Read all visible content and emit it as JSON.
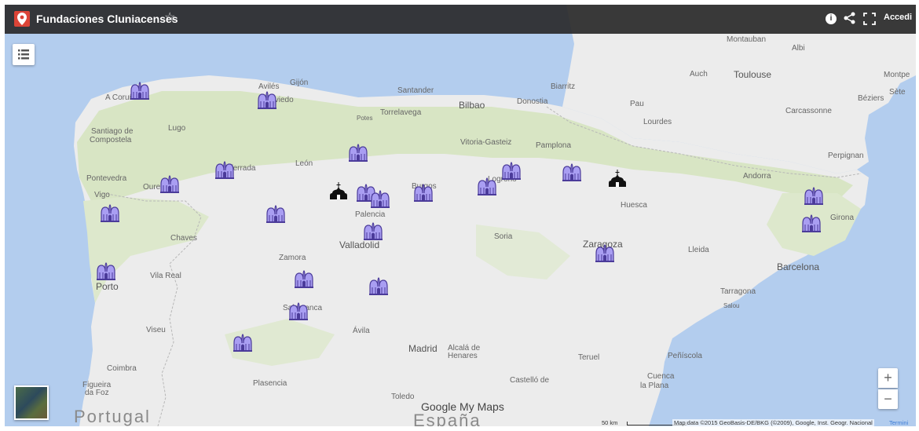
{
  "header": {
    "title": "Fundaciones Cluniacenses",
    "star_glyph": "☆",
    "info_glyph": "i",
    "signin_label": "Accedi"
  },
  "controls": {
    "zoom_in": "+",
    "zoom_out": "−"
  },
  "watermark": "Google My Maps",
  "footer": {
    "scale": "50 km",
    "attribution": "Map data ©2015 GeoBasis-DE/BKG (©2009), Google, Inst. Geogr. Nacional",
    "terms": "Termini"
  },
  "colors": {
    "sea": "#b3cdee",
    "land": "#ececec",
    "green_land": "#d8e5c4",
    "marker_fill": "#a99ef2",
    "marker_stroke": "#4b3b9a",
    "topbar": "#262626",
    "pin": "#db4437"
  },
  "labels": {
    "countries": [
      "Portugal",
      "España"
    ],
    "big_cities": [
      "Bilbao",
      "Toulouse",
      "Porto",
      "Madrid",
      "Barcelona",
      "Zaragoza",
      "Valladolid"
    ],
    "cities": [
      "Montauban",
      "Albi",
      "Auch",
      "Montpe",
      "Béziers",
      "Sète",
      "Carcassonne",
      "Perpignan",
      "Andorra",
      "Girona",
      "Biarritz",
      "Pau",
      "Lourdes",
      "Donostia",
      "Santander",
      "Avilés",
      "Gijón",
      "Oviedo",
      "A Coruña",
      "Torrelavega",
      "Potes",
      "Santiago de",
      "Compostela",
      "Lugo",
      "Vitoria-Gasteiz",
      "Pamplona",
      "León",
      "Ponferrada",
      "Pontevedra",
      "Ourense",
      "Vigo",
      "Burgos",
      "Logroño",
      "Huesca",
      "Palencia",
      "Chaves",
      "Soria",
      "Lleida",
      "Zamora",
      "Vila Real",
      "Salamanca",
      "Tarragona",
      "Salou",
      "Viseu",
      "Ávila",
      "Alcalá de",
      "Henares",
      "Coimbra",
      "Teruel",
      "Peñíscola",
      "Figueira",
      "da Foz",
      "Plasencia",
      "Cuenca",
      "Castelló de",
      "la Plana",
      "Toledo"
    ]
  },
  "markers": [
    {
      "kind": "monastery",
      "name": "monastery-a-coruna"
    },
    {
      "kind": "monastery",
      "name": "monastery-oviedo"
    },
    {
      "kind": "monastery",
      "name": "monastery-ponferrada"
    },
    {
      "kind": "monastery",
      "name": "monastery-ourense"
    },
    {
      "kind": "monastery",
      "name": "monastery-vigo"
    },
    {
      "kind": "monastery",
      "name": "monastery-leon-east"
    },
    {
      "kind": "monastery",
      "name": "monastery-palencia-1"
    },
    {
      "kind": "monastery",
      "name": "monastery-palencia-2"
    },
    {
      "kind": "monastery",
      "name": "monastery-burgos"
    },
    {
      "kind": "monastery",
      "name": "monastery-logrono-west"
    },
    {
      "kind": "monastery",
      "name": "monastery-logrono"
    },
    {
      "kind": "monastery",
      "name": "monastery-navarra"
    },
    {
      "kind": "monastery",
      "name": "monastery-benavente"
    },
    {
      "kind": "monastery",
      "name": "monastery-valladolid"
    },
    {
      "kind": "monastery",
      "name": "monastery-porto"
    },
    {
      "kind": "monastery",
      "name": "monastery-zamora"
    },
    {
      "kind": "monastery",
      "name": "monastery-cuellar"
    },
    {
      "kind": "monastery",
      "name": "monastery-salamanca"
    },
    {
      "kind": "monastery",
      "name": "monastery-guarda"
    },
    {
      "kind": "monastery",
      "name": "monastery-zaragoza"
    },
    {
      "kind": "monastery",
      "name": "monastery-catalonia-1"
    },
    {
      "kind": "monastery",
      "name": "monastery-catalonia-2"
    },
    {
      "kind": "church",
      "name": "church-sahagun"
    },
    {
      "kind": "church",
      "name": "church-jaca"
    }
  ]
}
